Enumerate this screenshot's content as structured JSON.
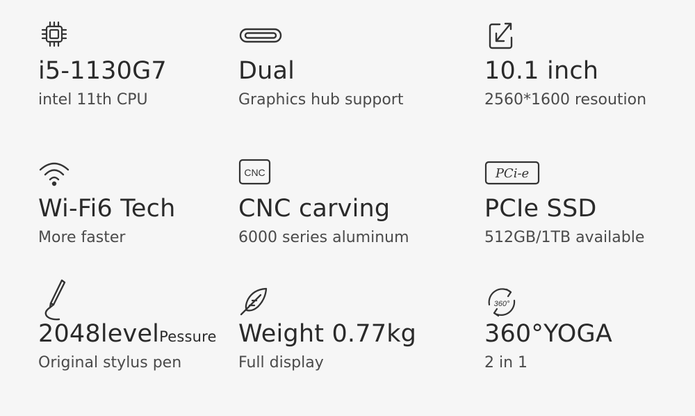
{
  "features": [
    {
      "icon": "cpu-chip-icon",
      "title": "i5-1130G7",
      "title_small": "",
      "subtitle": "intel 11th CPU"
    },
    {
      "icon": "usb-c-port-icon",
      "title": "Dual",
      "title_small": "",
      "subtitle": "Graphics hub support"
    },
    {
      "icon": "resize-arrow-icon",
      "title": "10.1 inch",
      "title_small": "",
      "subtitle": "2560*1600 resoution"
    },
    {
      "icon": "wifi-icon",
      "title": "Wi-Fi6 Tech",
      "title_small": "",
      "subtitle": "More faster"
    },
    {
      "icon": "cnc-badge-icon",
      "icon_text": "CNC",
      "title": "CNC carving",
      "title_small": "",
      "subtitle": "6000 series aluminum"
    },
    {
      "icon": "pcie-badge-icon",
      "icon_text": "PCi-e",
      "title": "PCIe SSD",
      "title_small": "",
      "subtitle": "512GB/1TB available"
    },
    {
      "icon": "stylus-pen-icon",
      "title": "2048level",
      "title_small": "Pessure",
      "subtitle": "Original stylus pen"
    },
    {
      "icon": "feather-icon",
      "title": "Weight 0.77kg",
      "title_small": "",
      "subtitle": "Full display"
    },
    {
      "icon": "rotate-360-icon",
      "icon_text": "360°",
      "title": "360°YOGA",
      "title_small": "",
      "subtitle": "2 in 1"
    }
  ]
}
